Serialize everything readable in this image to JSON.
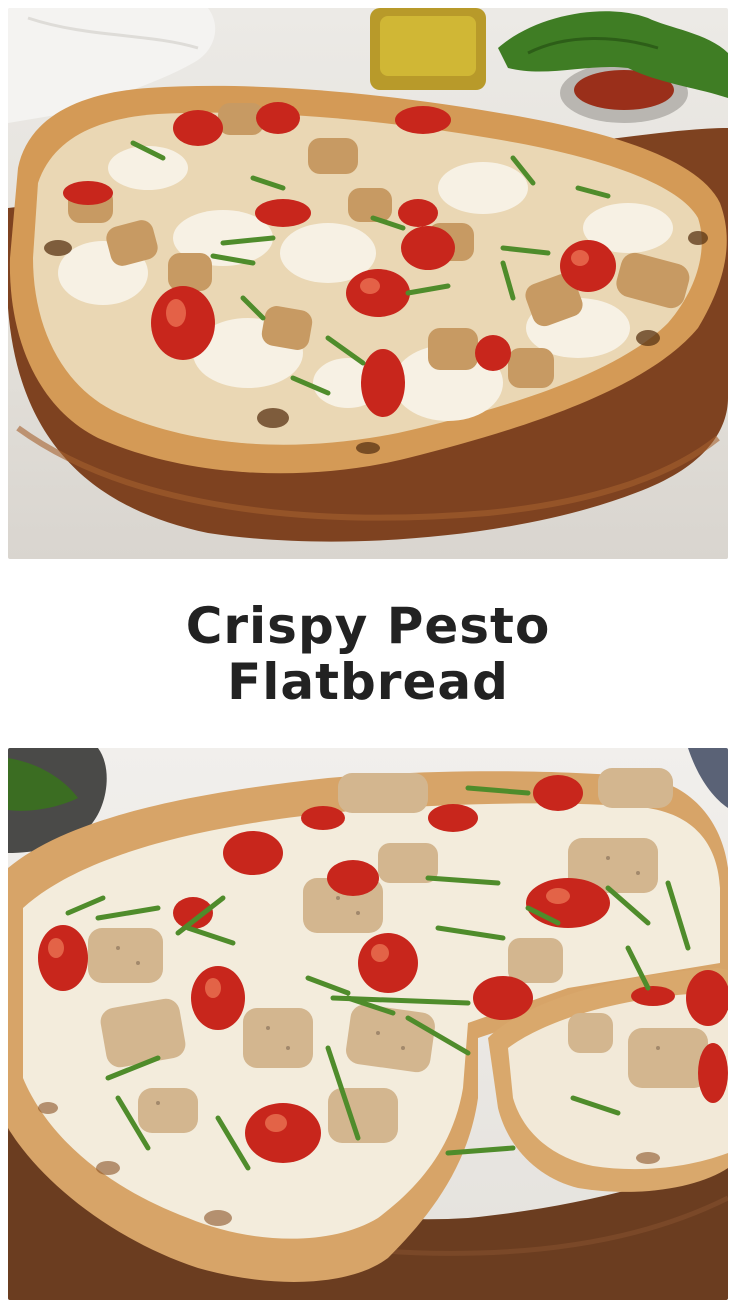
{
  "pin": {
    "title": "Crispy Pesto Flatbread"
  },
  "images": {
    "top": {
      "subject": "flatbread-with-chicken-tomatoes-mozzarella-on-wooden-board"
    },
    "bottom": {
      "subject": "sliced-flatbread-with-chicken-tomatoes-basil-on-cutting-board"
    }
  },
  "colors": {
    "title_text": "#222222",
    "background": "#ffffff",
    "crust": "#d9a35e",
    "board": "#8a4a24",
    "tomato": "#c8261c",
    "basil": "#4f8c2b",
    "cheese": "#f3ecdc"
  }
}
